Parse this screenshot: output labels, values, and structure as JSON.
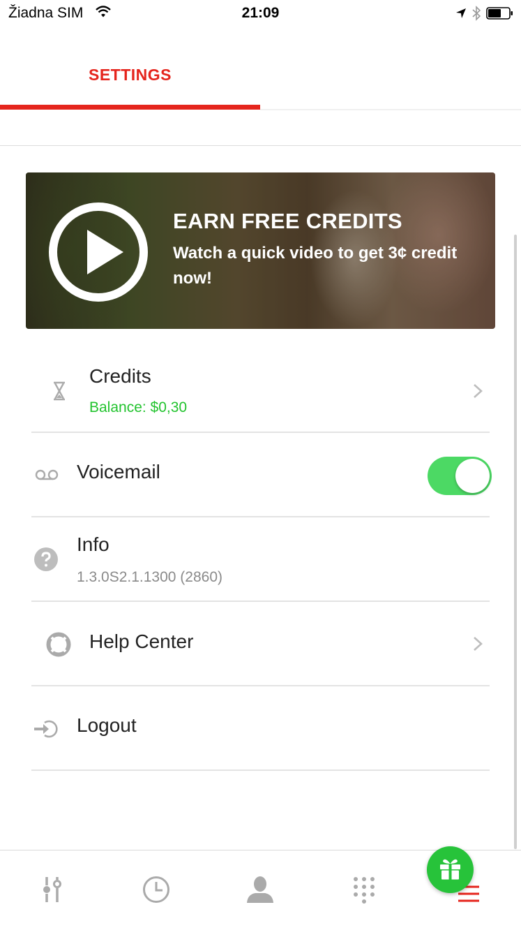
{
  "status_bar": {
    "carrier": "Žiadna SIM",
    "time": "21:09",
    "icons": [
      "wifi-icon",
      "location-arrow-icon",
      "bluetooth-icon",
      "battery-icon"
    ]
  },
  "tab": {
    "title": "SETTINGS",
    "accent_color": "#e5251d"
  },
  "promo": {
    "title": "EARN FREE CREDITS",
    "subtitle": "Watch a quick video to get 3¢ credit now!",
    "icon": "play-icon"
  },
  "rows": [
    {
      "label": "Credits",
      "sublabel": "Balance: $0,30",
      "sublabel_color": "#22c32e",
      "icon": "hourglass-icon",
      "trailing": "chevron-right-icon"
    },
    {
      "label": "Voicemail",
      "icon": "voicemail-icon",
      "trailing": "toggle",
      "toggle_on": true,
      "toggle_color": "#4cd964"
    },
    {
      "label": "Info",
      "sublabel": "1.3.0S2.1.1300 (2860)",
      "icon": "question-icon"
    },
    {
      "label": "Help Center",
      "icon": "lifebuoy-icon",
      "trailing": "chevron-right-icon"
    },
    {
      "label": "Logout",
      "icon": "logout-icon"
    }
  ],
  "bottom_nav": {
    "items": [
      "sliders-icon",
      "clock-icon",
      "contact-icon",
      "dialpad-icon",
      "menu-icon"
    ],
    "active": "menu-icon",
    "active_color": "#e5251d"
  },
  "gift_button": {
    "icon": "gift-icon",
    "color": "#27c33a"
  }
}
